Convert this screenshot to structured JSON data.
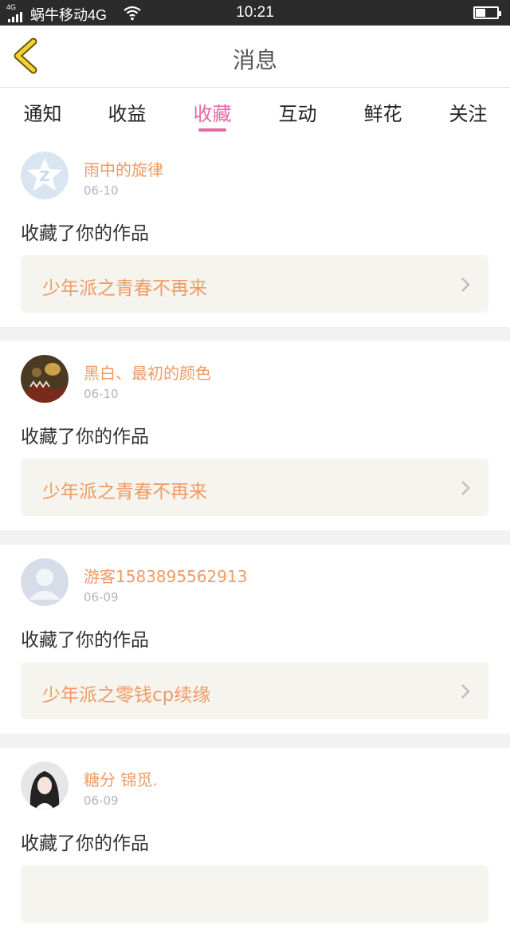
{
  "status_bar": {
    "network_small": "4G",
    "carrier": "蜗牛移动4G",
    "time": "10:21",
    "battery_level": 0.45
  },
  "header": {
    "title": "消息"
  },
  "tabs": [
    {
      "label": "通知",
      "active": false
    },
    {
      "label": "收益",
      "active": false
    },
    {
      "label": "收藏",
      "active": true
    },
    {
      "label": "互动",
      "active": false
    },
    {
      "label": "鲜花",
      "active": false
    },
    {
      "label": "关注",
      "active": false
    }
  ],
  "colors": {
    "accent": "#e46aa2",
    "name_orange": "#f09a64",
    "card_bg": "#f6f4ee"
  },
  "messages": [
    {
      "user": "雨中的旋律",
      "date": "06-10",
      "action": "收藏了你的作品",
      "work": "少年派之青春不再来",
      "avatar_icon": "qq-z-avatar-icon"
    },
    {
      "user": "黑白、最初的颜色",
      "date": "06-10",
      "action": "收藏了你的作品",
      "work": "少年派之青春不再来",
      "avatar_icon": "anime-avatar-icon"
    },
    {
      "user": "游客1583895562913",
      "date": "06-09",
      "action": "收藏了你的作品",
      "work": "少年派之零钱cp续缘",
      "avatar_icon": "default-user-avatar-icon"
    },
    {
      "user": "糖分 锦觅.",
      "date": "06-09",
      "action": "收藏了你的作品",
      "work": "",
      "avatar_icon": "photo-avatar-icon"
    }
  ]
}
